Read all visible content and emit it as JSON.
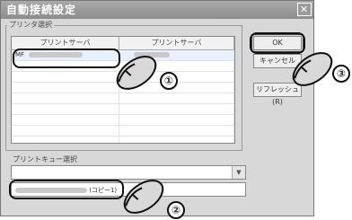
{
  "window": {
    "title": "自動接続設定",
    "close_glyph": "✕"
  },
  "printer_group": {
    "label": "プリンタ選択",
    "columns": [
      "プリントサーバ",
      "プリントサーバ"
    ],
    "rows": [
      {
        "prefix": "MF"
      }
    ]
  },
  "buttons": {
    "ok": "OK",
    "cancel": "キャンセル",
    "refresh": "リフレッシュ(R)"
  },
  "queue": {
    "label": "プリントキュー選択",
    "selected_suffix": "(コピー1)"
  },
  "callouts": [
    "①",
    "②",
    "③"
  ]
}
